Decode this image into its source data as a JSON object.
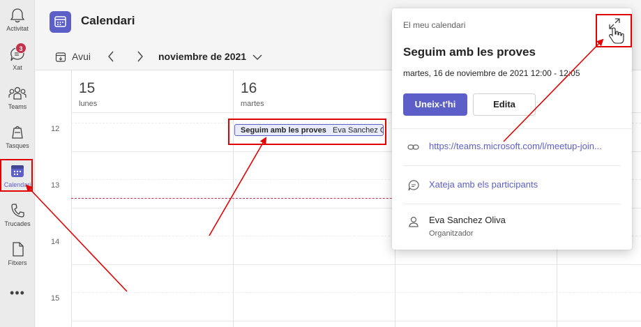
{
  "rail": {
    "items": [
      {
        "label": "Activitat"
      },
      {
        "label": "Xat",
        "badge": "3"
      },
      {
        "label": "Teams"
      },
      {
        "label": "Tasques"
      },
      {
        "label": "Calendari"
      },
      {
        "label": "Trucades"
      },
      {
        "label": "Fitxers"
      }
    ],
    "more": "•••"
  },
  "header": {
    "title": "Calendari"
  },
  "toolbar": {
    "today_label": "Avui",
    "month_label": "noviembre de 2021"
  },
  "calendar": {
    "days": [
      {
        "number": "15",
        "name": "lunes"
      },
      {
        "number": "16",
        "name": "martes"
      }
    ],
    "hours": [
      "12",
      "13",
      "14",
      "15"
    ],
    "event": {
      "title": "Seguim amb les proves",
      "organizer": "Eva Sanchez O"
    }
  },
  "popup": {
    "context": "El meu calendari",
    "title": "Seguim amb les proves",
    "time": "martes, 16 de noviembre de 2021 12:00 - 12:05",
    "join_label": "Uneix-t'hi",
    "edit_label": "Edita",
    "link": "https://teams.microsoft.com/l/meetup-join...",
    "chat_label": "Xateja amb els participants",
    "organizer_name": "Eva Sanchez Oliva",
    "organizer_role": "Organitzador"
  },
  "colors": {
    "accent": "#5b5fc7",
    "annotation": "#e00000",
    "badge": "#c4314b"
  }
}
